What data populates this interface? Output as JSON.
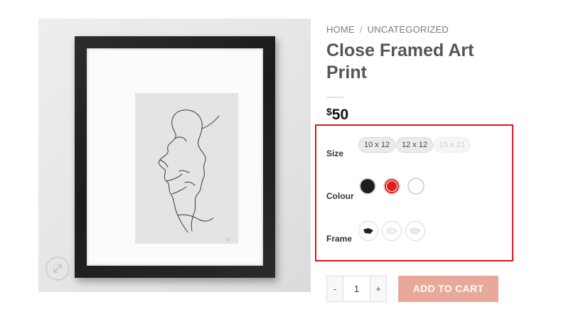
{
  "breadcrumb": {
    "home": "HOME",
    "separator": "/",
    "category": "UNCATEGORIZED"
  },
  "product": {
    "title": "Close Framed Art Print",
    "currency": "$",
    "price": "50"
  },
  "attributes": {
    "size": {
      "label": "Size",
      "options": [
        "10 x 12",
        "12 x 12",
        "15 x 21"
      ],
      "disabled": [
        "15 x 21"
      ]
    },
    "colour": {
      "label": "Colour",
      "options": [
        "black",
        "red",
        "white"
      ]
    },
    "frame": {
      "label": "Frame",
      "options": [
        "black-frame",
        "white-frame",
        "natural-frame"
      ]
    }
  },
  "cart": {
    "quantity": "1",
    "minus": "-",
    "plus": "+",
    "button": "ADD TO CART"
  },
  "colors": {
    "accent_button": "#e8a99a",
    "highlight_border": "#e0161b"
  },
  "icons": [
    "expand-icon",
    "frame-swatch-icon"
  ]
}
